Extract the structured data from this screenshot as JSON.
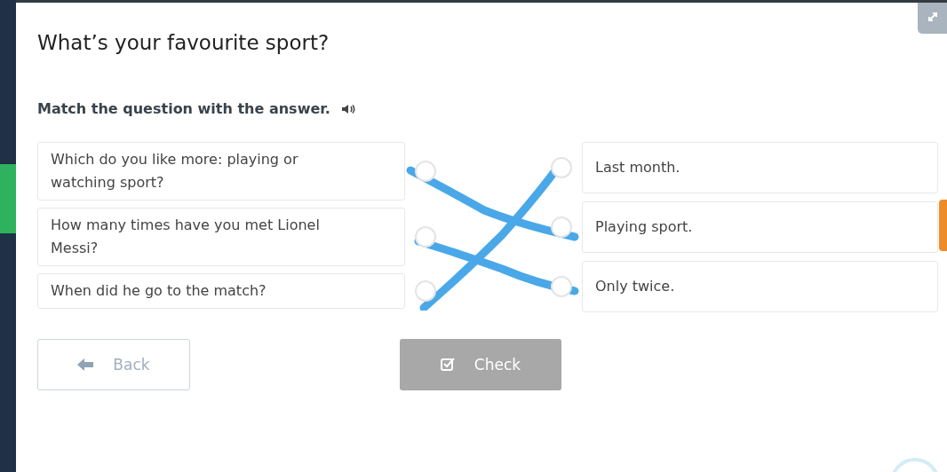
{
  "title": "What’s your favourite sport?",
  "instruction": "Match the question with the answer.",
  "questions": [
    {
      "text": "Which do you like more: playing or watching sport?",
      "selected": false
    },
    {
      "text": "How many times have you met Lionel Messi?",
      "selected": false
    },
    {
      "text": "When did he go to the match?",
      "selected": false
    }
  ],
  "answers": [
    {
      "text": "Last month.",
      "selected": false
    },
    {
      "text": "Playing sport.",
      "selected": false
    },
    {
      "text": "Only twice.",
      "selected": false
    }
  ],
  "buttons": [
    {
      "label": "Back",
      "kind": "back",
      "disabled": false
    },
    {
      "label": "Check",
      "kind": "check",
      "disabled": true
    }
  ]
}
